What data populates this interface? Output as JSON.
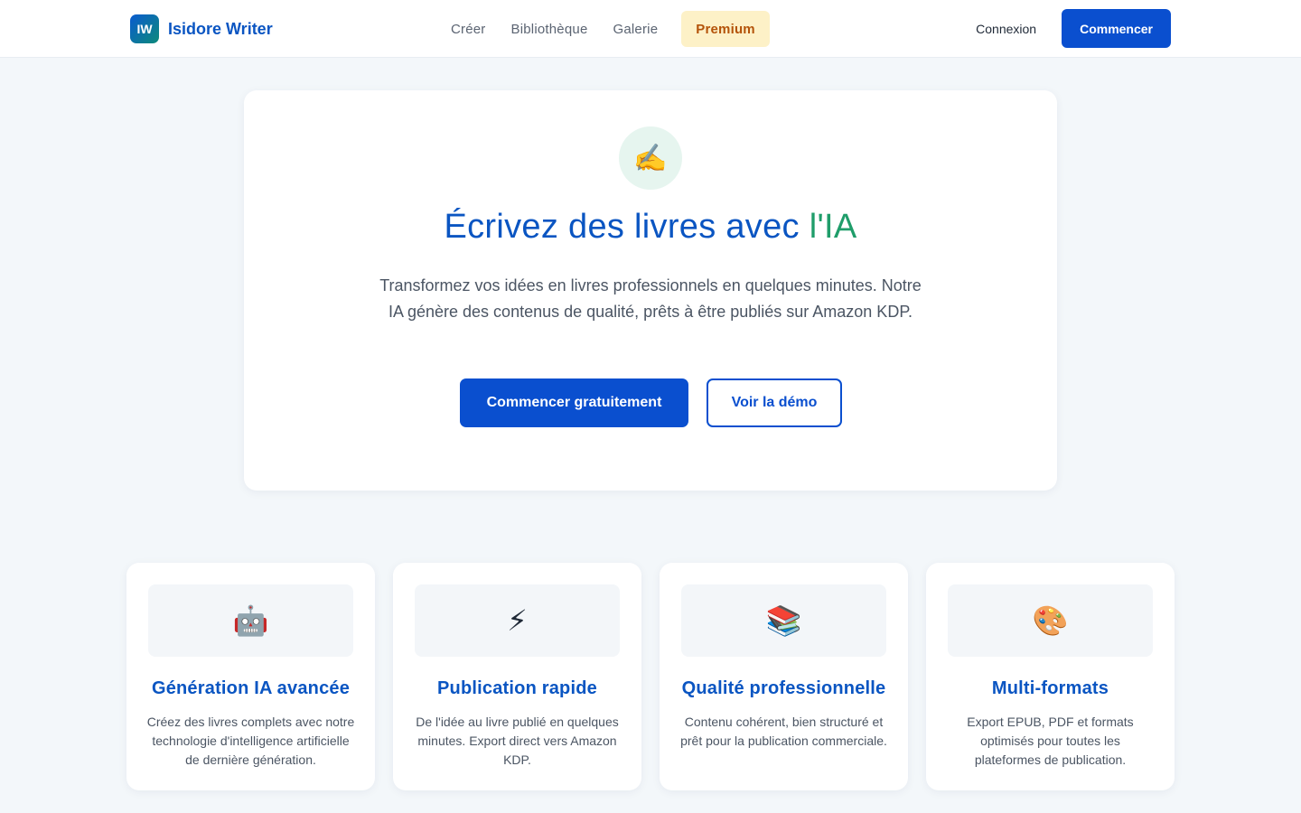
{
  "header": {
    "logo_text": "IW",
    "brand_name": "Isidore Writer",
    "nav": [
      {
        "label": "Créer"
      },
      {
        "label": "Bibliothèque"
      },
      {
        "label": "Galerie"
      },
      {
        "label": "Premium"
      }
    ],
    "login_label": "Connexion",
    "cta_label": "Commencer"
  },
  "hero": {
    "icon": "writing-hand-icon",
    "title_main": "Écrivez des livres avec ",
    "title_accent": "l'IA",
    "subtitle": "Transformez vos idées en livres professionnels en quelques minutes. Notre IA génère des contenus de qualité, prêts à être publiés sur Amazon KDP.",
    "primary_button": "Commencer gratuitement",
    "secondary_button": "Voir la démo"
  },
  "features": [
    {
      "icon": "robot-icon",
      "title": "Génération IA avancée",
      "description": "Créez des livres complets avec notre technologie d'intelligence artificielle de dernière génération."
    },
    {
      "icon": "lightning-icon",
      "title": "Publication rapide",
      "description": "De l'idée au livre publié en quelques minutes. Export direct vers Amazon KDP."
    },
    {
      "icon": "books-icon",
      "title": "Qualité professionnelle",
      "description": "Contenu cohérent, bien structuré et prêt pour la publication commerciale."
    },
    {
      "icon": "palette-icon",
      "title": "Multi-formats",
      "description": "Export EPUB, PDF et formats optimisés pour toutes les plateformes de publication."
    }
  ],
  "colors": {
    "primary": "#0a4fcf",
    "brand_text": "#0a55c2",
    "accent_green": "#1f9d6a",
    "premium_bg": "#fdf1c7",
    "premium_text": "#b45309",
    "page_bg": "#f3f7fa"
  }
}
